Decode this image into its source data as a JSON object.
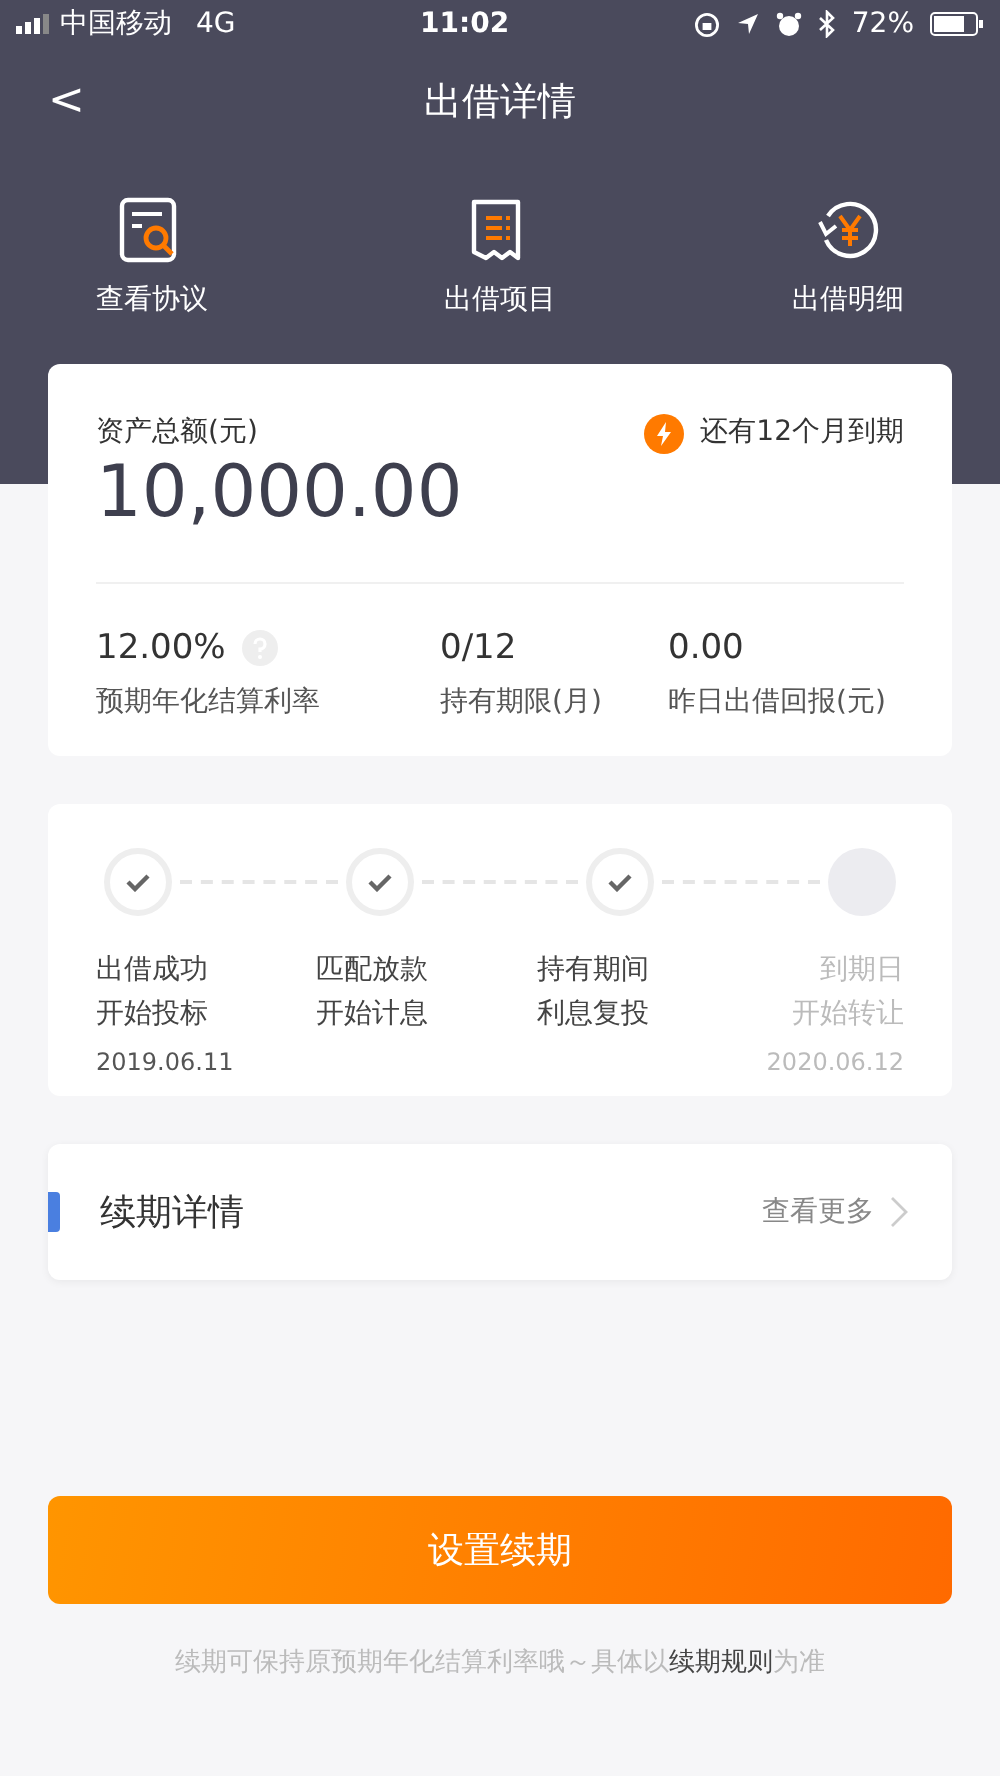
{
  "status_bar": {
    "carrier": "中国移动",
    "network": "4G",
    "time": "11:02",
    "battery": "72%"
  },
  "nav": {
    "back": "<",
    "title": "出借详情"
  },
  "shortcuts": [
    {
      "kind": "agreement",
      "label": "查看协议"
    },
    {
      "kind": "project",
      "label": "出借项目"
    },
    {
      "kind": "detail",
      "label": "出借明细"
    }
  ],
  "summary": {
    "total_label": "资产总额(元)",
    "total": "10,000.00",
    "maturity": "还有12个月到期",
    "stats": [
      {
        "value": "12.00%",
        "label": "预期年化结算利率",
        "help": true
      },
      {
        "value": "0/12",
        "label": "持有期限(月)",
        "help": false
      },
      {
        "value": "0.00",
        "label": "昨日出借回报(元)",
        "help": false
      }
    ]
  },
  "steps": [
    {
      "line1": "出借成功",
      "line2": "开始投标",
      "date": "2019.06.11",
      "done": true
    },
    {
      "line1": "匹配放款",
      "line2": "开始计息",
      "done": true
    },
    {
      "line1": "持有期间",
      "line2": "利息复投",
      "done": true
    },
    {
      "line1": "到期日",
      "line2": "开始转让",
      "date": "2020.06.12",
      "done": false
    }
  ],
  "renewal": {
    "title": "续期详情",
    "more": "查看更多"
  },
  "button": "设置续期",
  "footnote": {
    "before": "续期可保持原预期年化结算利率哦～具体以",
    "link": "续期规则",
    "after": "为准"
  }
}
